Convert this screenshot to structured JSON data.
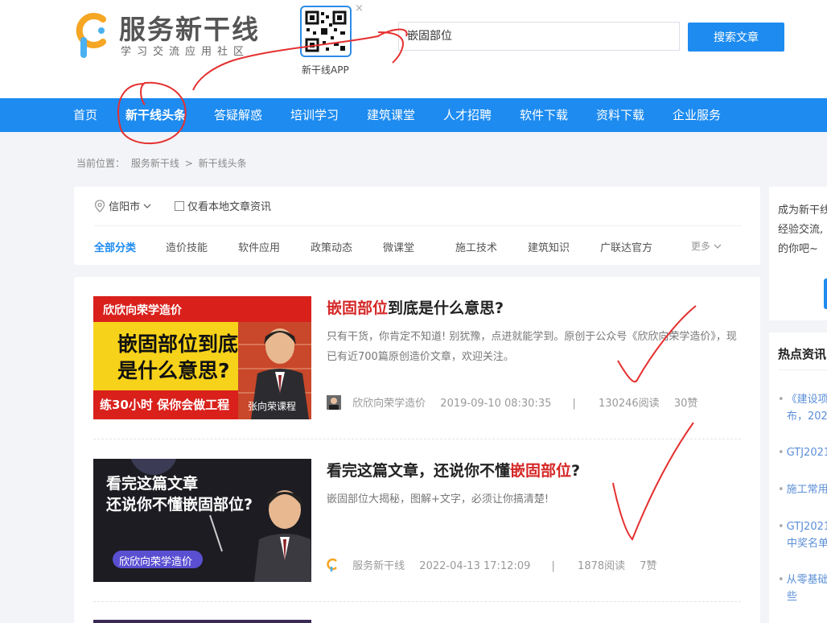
{
  "header": {
    "logo_title": "服务新干线",
    "logo_subtitle": "学习交流应用社区",
    "qr_label": "新干线APP",
    "qr_close": "×",
    "search_value": "嵌固部位",
    "search_button": "搜索文章"
  },
  "nav": {
    "items": [
      "首页",
      "新干线头条",
      "答疑解惑",
      "培训学习",
      "建筑课堂",
      "人才招聘",
      "软件下载",
      "资料下载",
      "企业服务"
    ],
    "active_index": 1
  },
  "breadcrumb": {
    "prefix": "当前位置：",
    "items": [
      "服务新干线",
      "新干线头条"
    ],
    "separator": ">"
  },
  "filter": {
    "location": "信阳市",
    "local_only_label": "仅看本地文章资讯",
    "local_only_checked": false,
    "categories": [
      "全部分类",
      "造价技能",
      "软件应用",
      "政策动态",
      "微课堂",
      "施工技术",
      "建筑知识",
      "广联达官方"
    ],
    "more_label": "更多"
  },
  "articles": [
    {
      "title_highlight": "嵌固部位",
      "title_rest": "到底是什么意思?",
      "description": "只有干货，你肯定不知道! 别犹豫，点进就能学到。原创于公众号《欣欣向荣学造价》，现已有近700篇原创造价文章，欢迎关注。",
      "author": "欣欣向荣学造价",
      "date": "2019-09-10 08:30:35",
      "reads": "130246阅读",
      "likes": "30赞",
      "thumb": {
        "banner": "欣欣向荣学造价",
        "headline1": "嵌固部位到底",
        "headline2": "是什么意思?",
        "slogan": "练30小时 保你会做工程",
        "teacher": "张向荣课程"
      }
    },
    {
      "title_prefix": "看完这篇文章，还说你不懂",
      "title_highlight": "嵌固部位",
      "title_suffix": "?",
      "description": "嵌固部位大揭秘，图解+文字，必须让你搞清楚!",
      "author": "服务新干线",
      "date": "2022-04-13 17:12:09",
      "reads": "1878阅读",
      "likes": "7赞",
      "thumb": {
        "headline1": "看完这篇文章",
        "headline2": "还说你不懂嵌固部位?",
        "badge": "欣欣向荣学造价"
      }
    }
  ],
  "sidebar": {
    "promo_lines": [
      "成为新干线",
      "经验交流,",
      "的你吧~"
    ],
    "hot_title": "热点资讯",
    "hot_items": [
      [
        "《建设项",
        "布，202"
      ],
      [
        "GTJ2021"
      ],
      [
        "施工常用"
      ],
      [
        "GTJ2021",
        "中奖名单"
      ],
      [
        "从零基础",
        "些"
      ]
    ]
  },
  "colors": {
    "primary": "#1d8bf0",
    "highlight": "#d52727",
    "annotation": "#e53030"
  }
}
